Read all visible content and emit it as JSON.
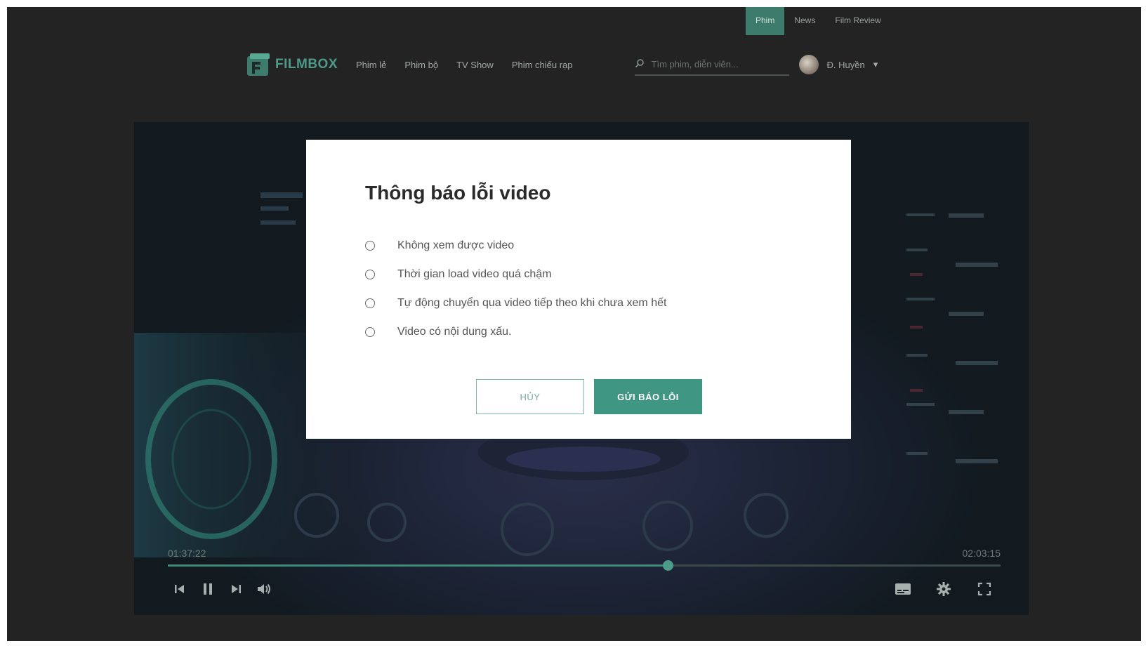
{
  "topnav": {
    "items": [
      {
        "label": "Phim",
        "active": true
      },
      {
        "label": "News",
        "active": false
      },
      {
        "label": "Film Review",
        "active": false
      }
    ]
  },
  "header": {
    "logo_text": "FILMBOX",
    "nav": [
      "Phim lẻ",
      "Phim bộ",
      "TV Show",
      "Phim chiếu rạp"
    ],
    "search_placeholder": "Tìm phim, diễn viên...",
    "user_name": "Đ. Huyền",
    "user_caret": "▾"
  },
  "player": {
    "time_current": "01:37:22",
    "time_total": "02:03:15",
    "progress_fraction": 0.6
  },
  "modal": {
    "title": "Thông báo lỗi video",
    "options": [
      "Không xem được video",
      "Thời gian load video quá chậm",
      "Tự động chuyển qua video tiếp theo khi chưa xem hết",
      "Video có nội dung xấu."
    ],
    "cancel_label": "HỦY",
    "submit_label": "GỬI BÁO LỖI"
  },
  "colors": {
    "accent": "#3f9683",
    "background": "#232323"
  }
}
